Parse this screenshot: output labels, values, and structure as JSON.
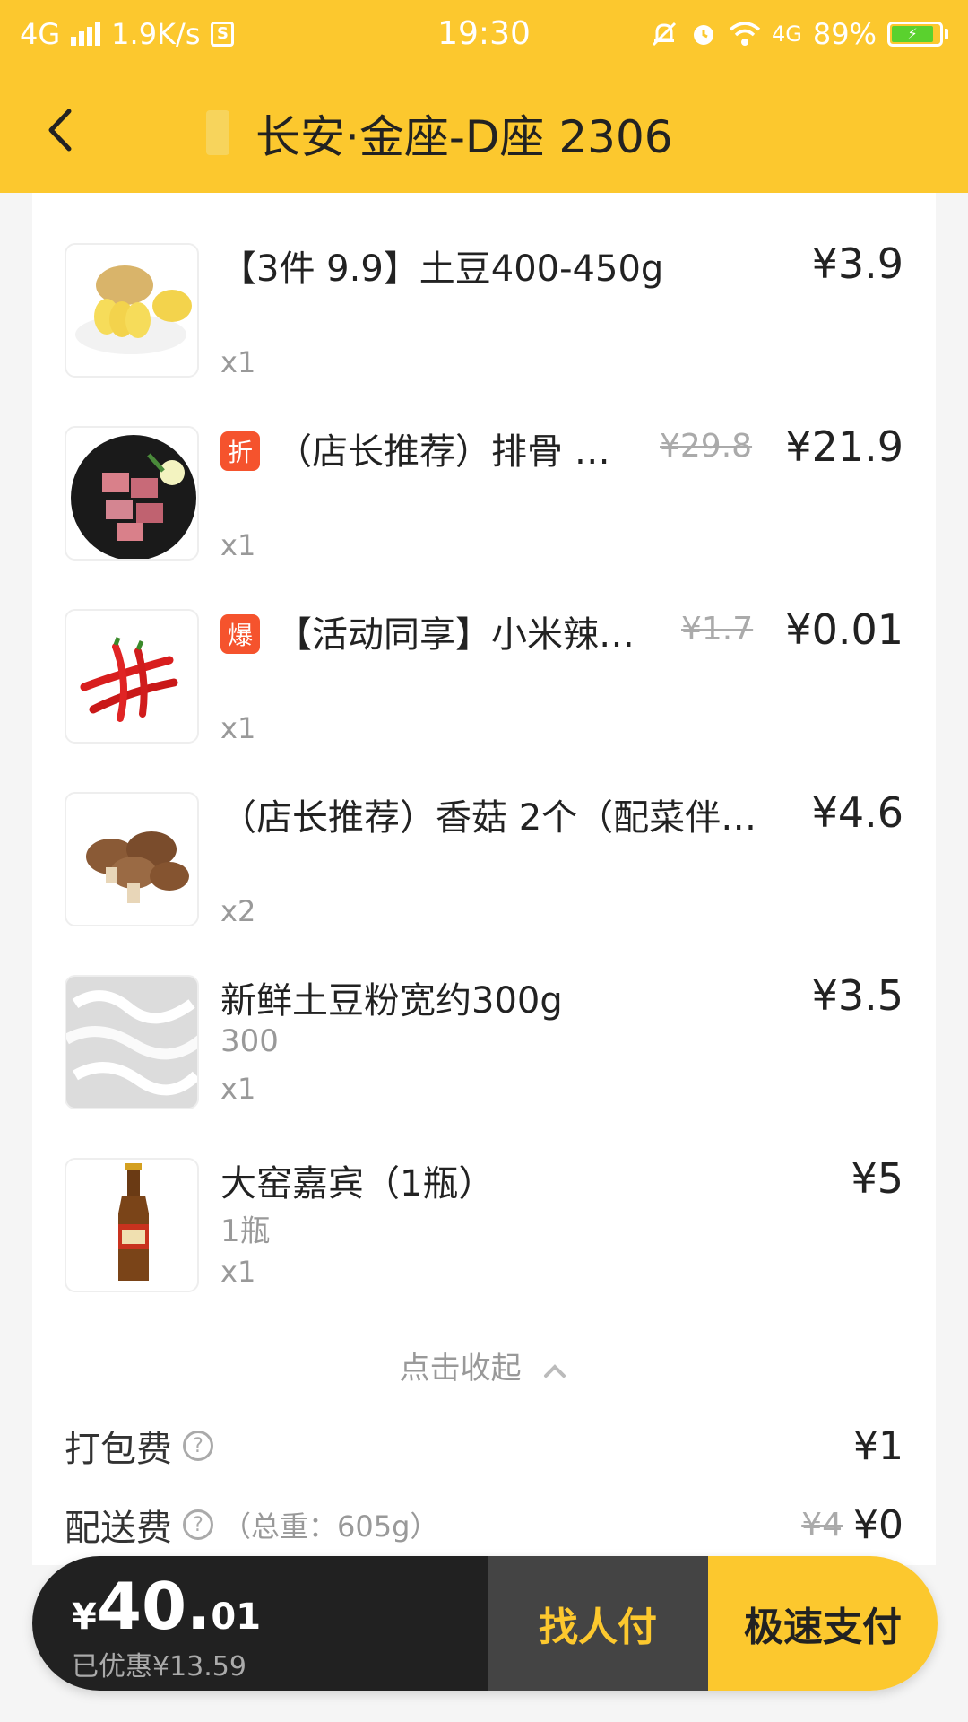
{
  "status_bar": {
    "network": "4G",
    "speed": "1.9K/s",
    "time": "19:30",
    "network_right": "4G",
    "battery": "89%"
  },
  "nav": {
    "title": "长安·金座-D座 2306"
  },
  "items": [
    {
      "name": "【3件 9.9】土豆400-450g",
      "price": "¥3.9",
      "qty": "x1",
      "icon": "potato-image"
    },
    {
      "tag": "折",
      "name": "（店长推荐）排骨 …",
      "orig_price": "¥29.8",
      "price": "¥21.9",
      "qty": "x1",
      "icon": "pork-ribs-image"
    },
    {
      "tag": "爆",
      "name": "【活动同享】小米辣…",
      "orig_price": "¥1.7",
      "price": "¥0.01",
      "qty": "x1",
      "icon": "chili-pepper-image"
    },
    {
      "name": "（店长推荐）香菇 2个（配菜伴…",
      "price": "¥4.6",
      "qty": "x2",
      "icon": "mushroom-image"
    },
    {
      "name": "新鲜土豆粉宽约300g",
      "spec": "300",
      "price": "¥3.5",
      "qty": "x1",
      "icon": "potato-noodle-image"
    },
    {
      "name": "大窑嘉宾（1瓶）",
      "spec": "1瓶",
      "price": "¥5",
      "qty": "x1",
      "icon": "beer-bottle-image"
    }
  ],
  "collapse_label": "点击收起",
  "fees": {
    "packing_label": "打包费",
    "packing_value": "¥1",
    "delivery_label": "配送费",
    "delivery_note": "（总重：605g）",
    "delivery_orig": "¥4",
    "delivery_value": "¥0"
  },
  "paybar": {
    "yen": "¥",
    "total_int": "40.",
    "total_dec": "01",
    "discount": "已优惠¥13.59",
    "friend_pay": "找人付",
    "fast_pay": "极速支付"
  },
  "colors": {
    "brand_yellow": "#fcc82e",
    "tag_red": "#f5532d",
    "pay_dark": "#212121"
  }
}
